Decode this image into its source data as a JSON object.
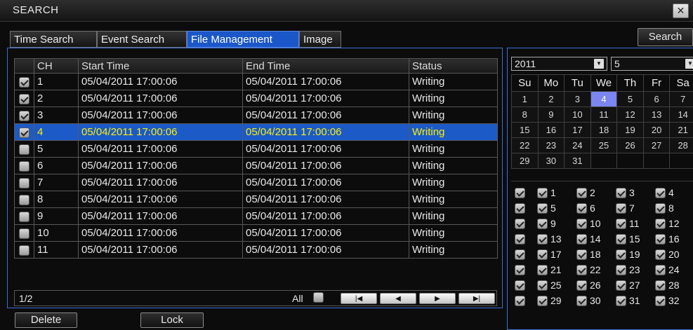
{
  "window": {
    "title": "SEARCH",
    "close_glyph": "✕"
  },
  "tabs": [
    "Time Search",
    "Event Search",
    "File Management",
    "Image"
  ],
  "search_button": "Search",
  "table": {
    "columns": [
      "CH",
      "Start Time",
      "End Time",
      "Status"
    ],
    "selected_index": 3,
    "rows": [
      {
        "ch": "1",
        "start": "05/04/2011 17:00:06",
        "end": "05/04/2011 17:00:06",
        "status": "Writing",
        "checked": true
      },
      {
        "ch": "2",
        "start": "05/04/2011 17:00:06",
        "end": "05/04/2011 17:00:06",
        "status": "Writing",
        "checked": true
      },
      {
        "ch": "3",
        "start": "05/04/2011 17:00:06",
        "end": "05/04/2011 17:00:06",
        "status": "Writing",
        "checked": true
      },
      {
        "ch": "4",
        "start": "05/04/2011 17:00:06",
        "end": "05/04/2011 17:00:06",
        "status": "Writing",
        "checked": true
      },
      {
        "ch": "5",
        "start": "05/04/2011 17:00:06",
        "end": "05/04/2011 17:00:06",
        "status": "Writing",
        "checked": false
      },
      {
        "ch": "6",
        "start": "05/04/2011 17:00:06",
        "end": "05/04/2011 17:00:06",
        "status": "Writing",
        "checked": false
      },
      {
        "ch": "7",
        "start": "05/04/2011 17:00:06",
        "end": "05/04/2011 17:00:06",
        "status": "Writing",
        "checked": false
      },
      {
        "ch": "8",
        "start": "05/04/2011 17:00:06",
        "end": "05/04/2011 17:00:06",
        "status": "Writing",
        "checked": false
      },
      {
        "ch": "9",
        "start": "05/04/2011 17:00:06",
        "end": "05/04/2011 17:00:06",
        "status": "Writing",
        "checked": false
      },
      {
        "ch": "10",
        "start": "05/04/2011 17:00:06",
        "end": "05/04/2011 17:00:06",
        "status": "Writing",
        "checked": false
      },
      {
        "ch": "11",
        "start": "05/04/2011 17:00:06",
        "end": "05/04/2011 17:00:06",
        "status": "Writing",
        "checked": false
      }
    ]
  },
  "pagination": {
    "page_label": "1/2",
    "all_label": "All",
    "buttons": [
      {
        "name": "first-page-button",
        "glyph": "|◀"
      },
      {
        "name": "prev-page-button",
        "glyph": "◀"
      },
      {
        "name": "next-page-button",
        "glyph": "▶"
      },
      {
        "name": "last-page-button",
        "glyph": "▶|"
      }
    ]
  },
  "actions": {
    "delete": "Delete",
    "lock": "Lock"
  },
  "calendar": {
    "year": "2011",
    "month": "5",
    "weekdays": [
      "Su",
      "Mo",
      "Tu",
      "We",
      "Th",
      "Fr",
      "Sa"
    ],
    "weeks": [
      [
        "1",
        "2",
        "3",
        "4",
        "5",
        "6",
        "7"
      ],
      [
        "8",
        "9",
        "10",
        "11",
        "12",
        "13",
        "14"
      ],
      [
        "15",
        "16",
        "17",
        "18",
        "19",
        "20",
        "21"
      ],
      [
        "22",
        "23",
        "24",
        "25",
        "26",
        "27",
        "28"
      ],
      [
        "29",
        "30",
        "31",
        "",
        "",
        "",
        ""
      ]
    ],
    "highlighted_day": "4"
  },
  "channel_grid": {
    "rows": [
      [
        "1",
        "2",
        "3",
        "4"
      ],
      [
        "5",
        "6",
        "7",
        "8"
      ],
      [
        "9",
        "10",
        "11",
        "12"
      ],
      [
        "13",
        "14",
        "15",
        "16"
      ],
      [
        "17",
        "18",
        "19",
        "20"
      ],
      [
        "21",
        "22",
        "23",
        "24"
      ],
      [
        "25",
        "26",
        "27",
        "28"
      ],
      [
        "29",
        "30",
        "31",
        "32"
      ]
    ]
  },
  "colors": {
    "accent": "#1b57c9",
    "selected_row_text": "#ffef00",
    "panel_border": "#3c6fd6",
    "calendar_highlight": "#7b86f0"
  }
}
